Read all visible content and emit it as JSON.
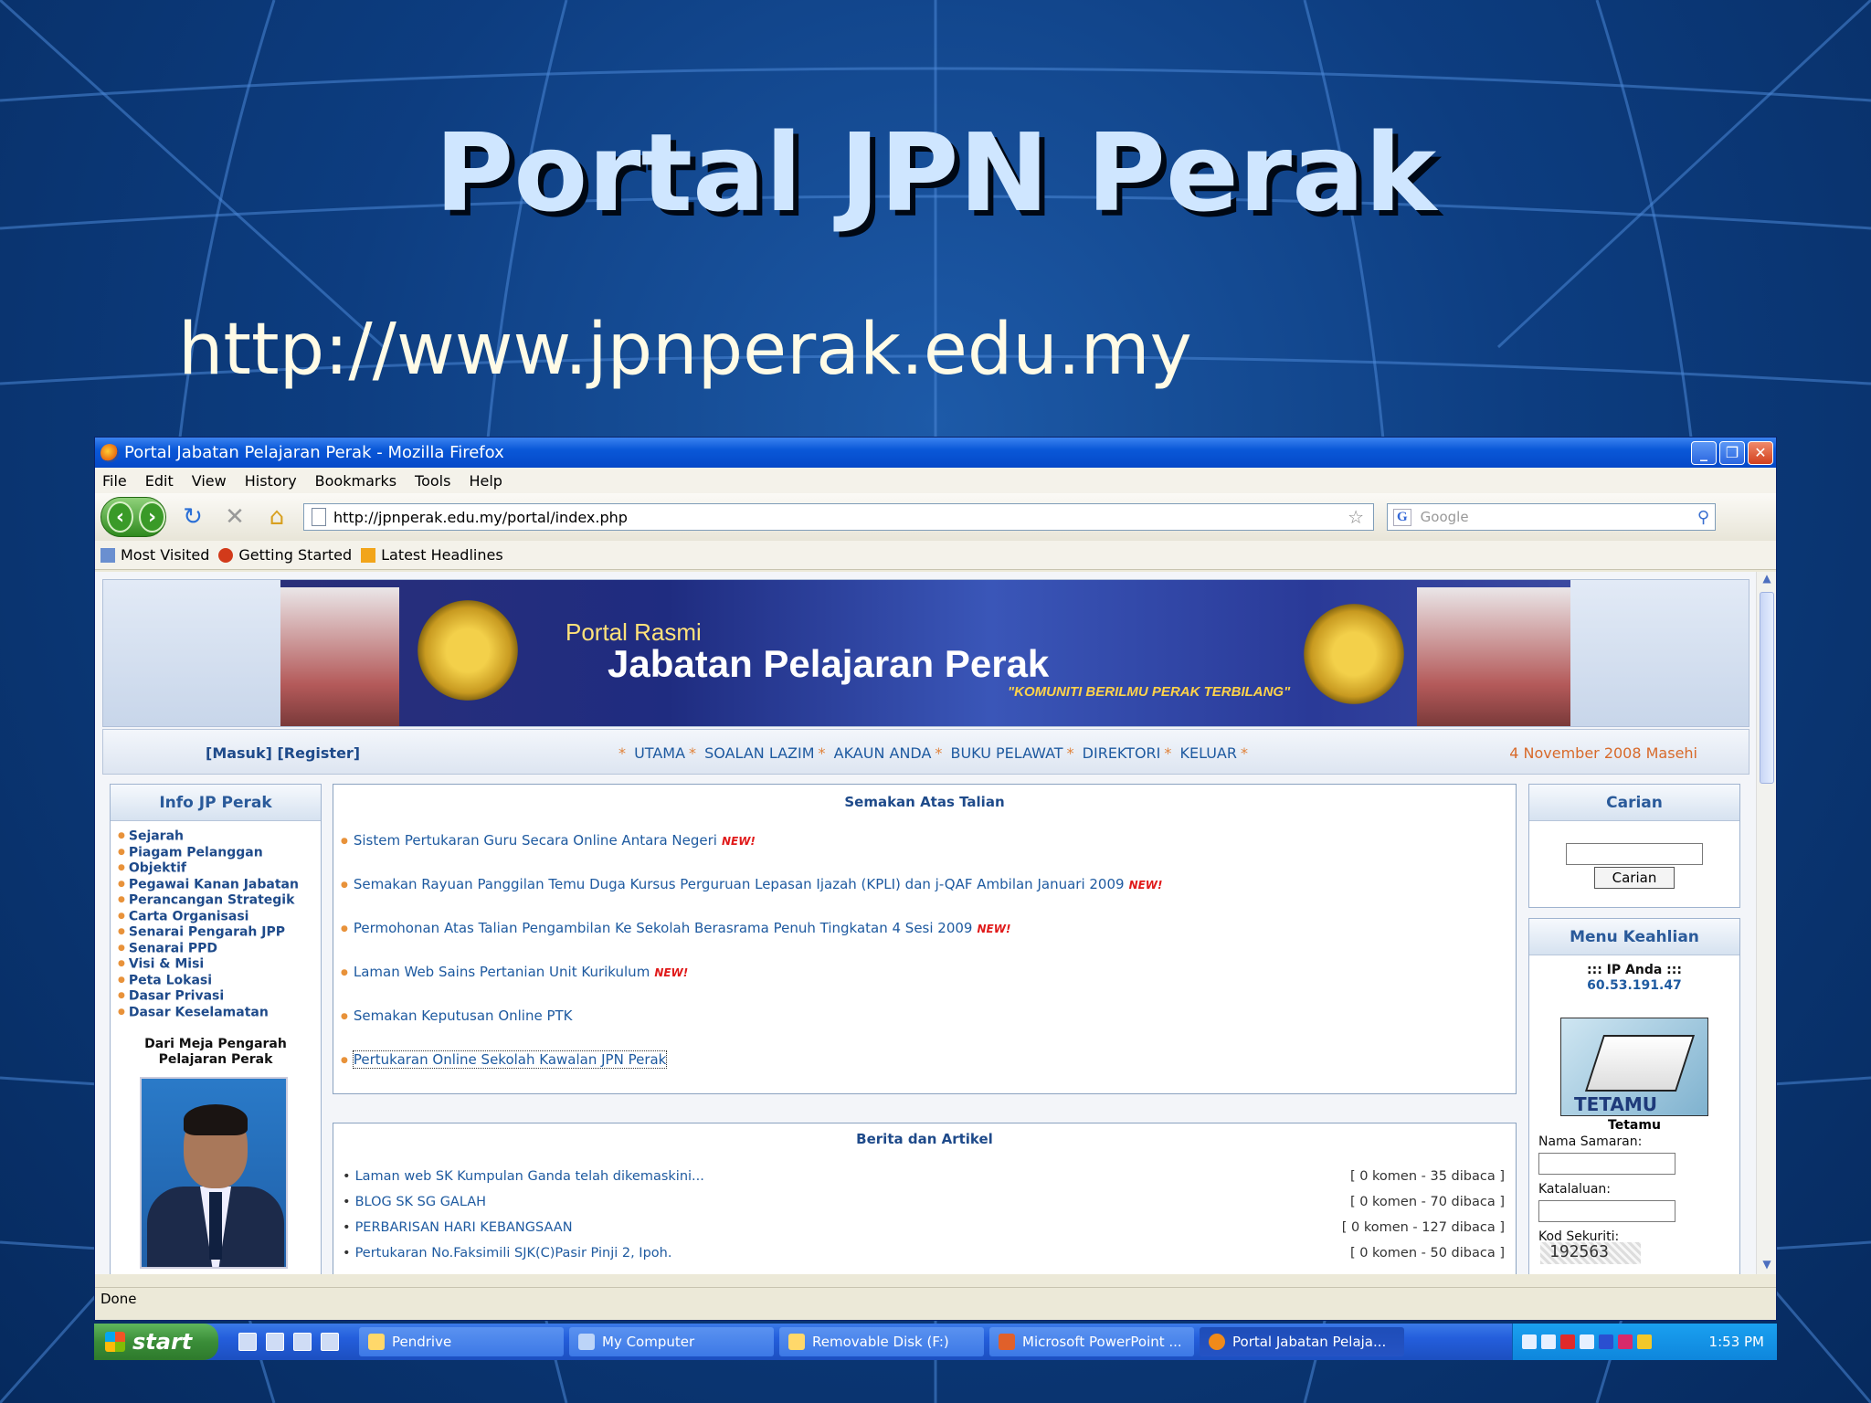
{
  "slide": {
    "title": "Portal JPN Perak",
    "url": "http://www.jpnperak.edu.my"
  },
  "browser": {
    "window_title": "Portal Jabatan Pelajaran Perak - Mozilla Firefox",
    "menu": [
      "File",
      "Edit",
      "View",
      "History",
      "Bookmarks",
      "Tools",
      "Help"
    ],
    "address": "http://jpnperak.edu.my/portal/index.php",
    "search_placeholder": "Google",
    "bookmarks": [
      "Most Visited",
      "Getting Started",
      "Latest Headlines"
    ],
    "status": "Done"
  },
  "site": {
    "banner": {
      "subtitle": "Portal Rasmi",
      "title": "Jabatan Pelajaran Perak",
      "motto": "\"KOMUNITI BERILMU PERAK TERBILANG\""
    },
    "topnav": {
      "login": "[Masuk] [Register]",
      "links": [
        "UTAMA",
        "SOALAN LAZIM",
        "AKAUN ANDA",
        "BUKU PELAWAT",
        "DIREKTORI",
        "KELUAR"
      ],
      "date": "4 November 2008 Masehi"
    },
    "left": {
      "title": "Info JP Perak",
      "items": [
        "Sejarah",
        "Piagam Pelanggan",
        "Objektif",
        "Pegawai Kanan Jabatan",
        "Perancangan Strategik",
        "Carta Organisasi",
        "Senarai Pengarah JPP",
        "Senarai PPD",
        "Visi & Misi",
        "Peta Lokasi",
        "Dasar Privasi",
        "Dasar Keselamatan"
      ],
      "desk_line1": "Dari Meja Pengarah",
      "desk_line2": "Pelajaran Perak"
    },
    "center": {
      "title": "Semakan Atas Talian",
      "new_label": "NEW!",
      "items": [
        "Sistem Pertukaran Guru Secara Online Antara Negeri",
        "Semakan Rayuan Panggilan Temu Duga Kursus Perguruan Lepasan Ijazah (KPLI) dan j-QAF Ambilan Januari 2009",
        "Permohonan Atas Talian Pengambilan Ke Sekolah Berasrama Penuh Tingkatan 4 Sesi 2009",
        "Laman Web Sains Pertanian Unit Kurikulum",
        "Semakan Keputusan Online PTK",
        "Pertukaran Online Sekolah Kawalan JPN Perak"
      ]
    },
    "news": {
      "title": "Berita dan Artikel",
      "rows": [
        {
          "title": "Laman web SK Kumpulan Ganda telah dikemaskini...",
          "count": "[ 0 komen - 35 dibaca ]"
        },
        {
          "title": "BLOG SK SG GALAH",
          "count": "[ 0 komen - 70 dibaca ]"
        },
        {
          "title": "PERBARISAN HARI KEBANGSAAN",
          "count": "[ 0 komen - 127 dibaca ]"
        },
        {
          "title": "Pertukaran No.Faksimili SJK(C)Pasir Pinji 2, Ipoh.",
          "count": "[ 0 komen - 50 dibaca ]"
        }
      ]
    },
    "right": {
      "search_title": "Carian",
      "search_button": "Carian",
      "menu_title": "Menu Keahlian",
      "ip_label": "::: IP Anda :::",
      "ip_value": "60.53.191.47",
      "guest_img_label": "TETAMU",
      "guest_label": "Tetamu",
      "username_label": "Nama Samaran:",
      "password_label": "Katalaluan:",
      "security_label": "Kod Sekuriti:",
      "security_code": "192563"
    }
  },
  "taskbar": {
    "start": "start",
    "tasks": [
      "Pendrive",
      "My Computer",
      "Removable Disk (F:)",
      "Microsoft PowerPoint ...",
      "Portal Jabatan Pelaja..."
    ],
    "clock": "1:53 PM"
  }
}
